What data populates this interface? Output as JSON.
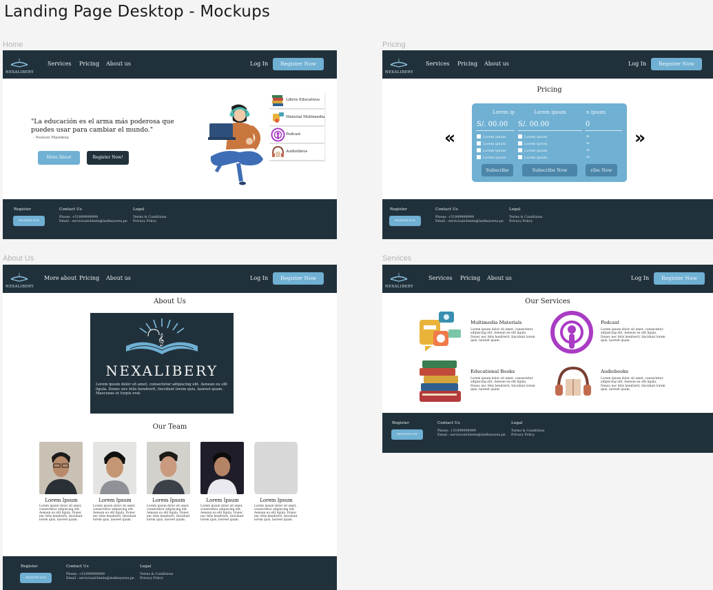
{
  "page_title": "Landing Page Desktop - Mockups",
  "frames": {
    "home_label": "Home",
    "pricing_label": "Pricing",
    "about_label": "About Us",
    "services_label": "Services"
  },
  "brand": {
    "logo_text": "NEXALIBERY",
    "navy": "#21313b",
    "accent": "#6fb0d3"
  },
  "nav": {
    "home": [
      "Services",
      "Pricing",
      "About us"
    ],
    "pricing": [
      "Services",
      "Pricing",
      "About us"
    ],
    "about": [
      "More about",
      "Pricing",
      "About us"
    ],
    "services": [
      "Services",
      "Pricing",
      "About us"
    ],
    "login": "Log In",
    "register": "Register Now"
  },
  "home": {
    "quote": "\"La educación es el arma más poderosa que puedes usar para cambiar el mundo.\"",
    "author": "- Nelson Mandela",
    "more_about": "More About",
    "register_now": "Register Now!",
    "side_items": [
      "Libros Educativos",
      "Material Multimedia",
      "Podcast",
      "Audiolibros"
    ]
  },
  "pricing": {
    "title": "Pricing",
    "plans": [
      {
        "name": "Lorem ip",
        "price": "S/. 00.00",
        "button": "Subscribe"
      },
      {
        "name": "Lorem ipsum",
        "price": "S/. 00.00",
        "button": "Subscribe Now"
      },
      {
        "name": "n ipsum",
        "price": "0",
        "button": "ribe Now"
      }
    ],
    "feature": "Lorem ipsum",
    "feature_cut": "m",
    "prev": "«",
    "next": "»"
  },
  "about": {
    "title": "About Us",
    "brand": "NEXALIBERY",
    "text": "Lorem ipsum dolor sit amet, consectetur adipiscing elit. Aenean eu elit ligula. Donec nec felis hendrerit, tincidunt lorem quis, laoreet quam. Maecenas et turpis erat.",
    "team_title": "Our Team",
    "member_name": "Lorem Ipsum",
    "member_text": "Lorem ipsum dolor sit amet, consectetur adipiscing elit. Aenean eu elit ligula. Donec nec felis hendrerit, tincidunt lorem quis, laoreet quam."
  },
  "services": {
    "title": "Our Services",
    "items": [
      {
        "name": "Multimedia Materials"
      },
      {
        "name": "Podcast"
      },
      {
        "name": "Educational Books"
      },
      {
        "name": "Audiobooks"
      }
    ],
    "text": "Lorem ipsum dolor sit amet, consectetur adipiscing elit. Aenean eu elit ligula. Donec nec felis hendrerit, tincidunt lorem quis, laoreet quam."
  },
  "footer": {
    "register": "Register",
    "button": "REGISTER NOW",
    "contact": "Contact Us",
    "phone": "Phone: +51999999999",
    "email": "Email : servicioalcliente@lastkeyarea.pe",
    "legal": "Legal",
    "terms": "Terms & Conditions",
    "privacy": "Privacy Policy"
  }
}
